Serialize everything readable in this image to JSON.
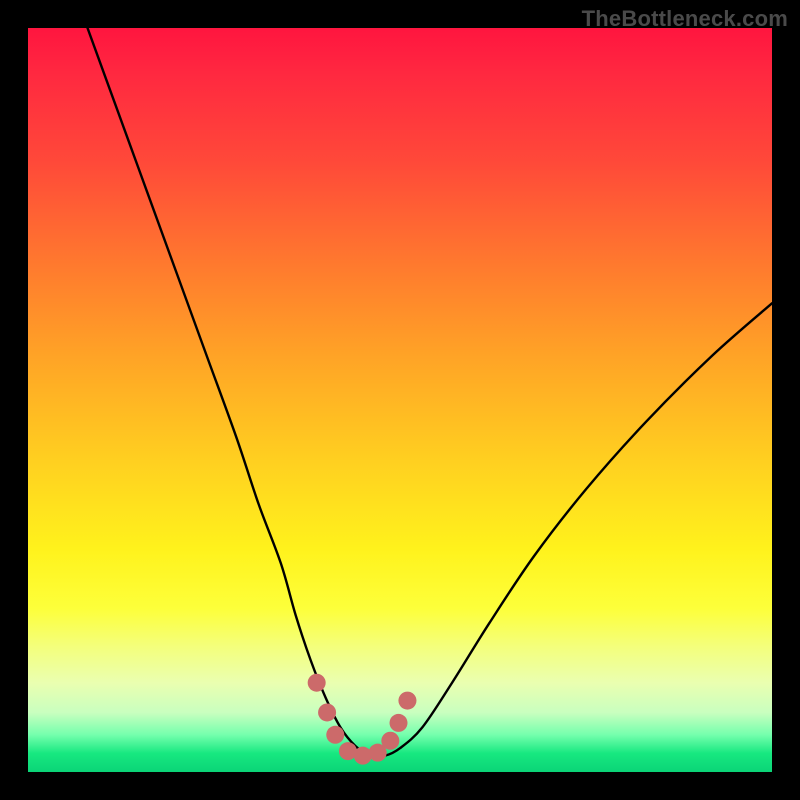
{
  "watermark": "TheBottleneck.com",
  "chart_data": {
    "type": "line",
    "title": "",
    "xlabel": "",
    "ylabel": "",
    "xlim": [
      0,
      100
    ],
    "ylim": [
      0,
      100
    ],
    "grid": false,
    "legend": false,
    "background_gradient_stops": [
      {
        "pos": 0,
        "color": "#ff153f"
      },
      {
        "pos": 18,
        "color": "#ff4939"
      },
      {
        "pos": 44,
        "color": "#ffa326"
      },
      {
        "pos": 70,
        "color": "#fff21c"
      },
      {
        "pos": 88,
        "color": "#eaffb0"
      },
      {
        "pos": 97.5,
        "color": "#17e880"
      },
      {
        "pos": 100,
        "color": "#0bd477"
      }
    ],
    "series": [
      {
        "name": "bottleneck-curve",
        "color": "#000000",
        "x": [
          8,
          12,
          16,
          20,
          24,
          28,
          31,
          34,
          36,
          38,
          40,
          42,
          44,
          46,
          48,
          50,
          53,
          57,
          62,
          68,
          75,
          83,
          92,
          100
        ],
        "y": [
          100,
          89,
          78,
          67,
          56,
          45,
          36,
          28,
          21,
          15,
          10,
          6,
          3.5,
          2.2,
          2.2,
          3.2,
          6,
          12,
          20,
          29,
          38,
          47,
          56,
          63
        ]
      },
      {
        "name": "trough-markers",
        "type": "scatter",
        "color": "#cc6a6a",
        "marker_radius_px": 9,
        "x": [
          38.8,
          40.2,
          41.3,
          43.0,
          45.0,
          47.0,
          48.7,
          49.8,
          51.0
        ],
        "y": [
          12.0,
          8.0,
          5.0,
          2.8,
          2.2,
          2.6,
          4.2,
          6.6,
          9.6
        ]
      }
    ],
    "annotations": []
  }
}
